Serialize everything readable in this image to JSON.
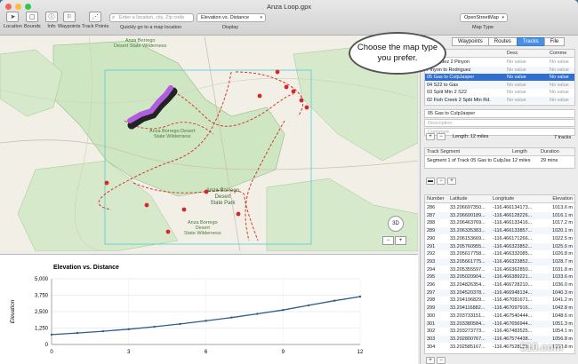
{
  "window": {
    "title": "Anza Loop.gpx"
  },
  "toolbar": {
    "items": [
      {
        "label": "Location",
        "icon": "location-arrow-icon"
      },
      {
        "label": "Bounds",
        "icon": "bounds-icon"
      },
      {
        "label": "Info",
        "icon": "info-icon"
      },
      {
        "label": "Waypoints",
        "icon": "waypoints-icon"
      },
      {
        "label": "Track Points",
        "icon": "track-points-icon"
      }
    ],
    "search_placeholder": "Enter a location, city, Zip code",
    "search_caption": "Quickly go to a map location",
    "display_value": "Elevation vs. Distance",
    "display_caption": "Display",
    "maptype_value": "OpenStreetMap",
    "maptype_caption": "Map Type"
  },
  "map": {
    "labels": {
      "park_north": "Anza Borrego\nDesert State Wilderness",
      "park_mid": "Anza Borrego Desert\nState Wilderness",
      "park_center": "Anza-Borrego\nDesert\nState Park",
      "park_south": "Anza Borrego\nDesert\nState Wilderness"
    },
    "zoom_3d": "3D",
    "zoom_minus": "−",
    "zoom_plus": "+"
  },
  "chart_data": {
    "type": "line",
    "title": "Elevation vs. Distance",
    "ylabel": "Elevation",
    "xlabel": "",
    "xlim": [
      0,
      12
    ],
    "ylim": [
      0,
      5000
    ],
    "xticks": [
      "0",
      "3",
      "6",
      "9",
      "12"
    ],
    "yticks": [
      "0",
      "1,250",
      "2,500",
      "3,750",
      "5,000"
    ],
    "x": [
      0,
      1,
      2,
      3,
      4,
      5,
      6,
      7,
      8,
      9,
      10,
      11,
      12
    ],
    "y": [
      750,
      870,
      1010,
      1160,
      1350,
      1560,
      1800,
      2050,
      2330,
      2620,
      2980,
      3330,
      3640
    ]
  },
  "right_panel": {
    "tabs": [
      "Waypoints",
      "Routes",
      "Tracks",
      "File"
    ],
    "selected_tab": "Tracks",
    "tracks_header": [
      "Name",
      "Desc",
      "Comme"
    ],
    "tracks": [
      {
        "name": "Rodriguez 2 Pinyon",
        "desc": "No value",
        "comm": "No value",
        "selected": false
      },
      {
        "name": "Pinyon to Rodriguez",
        "desc": "No value",
        "comm": "No value",
        "selected": false
      },
      {
        "name": "05 Gas to CulpJasper",
        "desc": "No value",
        "comm": "No value",
        "selected": true
      },
      {
        "name": "04 S22 to Gas",
        "desc": "No value",
        "comm": "No value",
        "selected": false
      },
      {
        "name": "03 Split Mtn 2 S22",
        "desc": "No value",
        "comm": "No value",
        "selected": false
      },
      {
        "name": "02 Fish Creek 2 Split Mtn Rd.",
        "desc": "No value",
        "comm": "No value",
        "selected": false
      }
    ],
    "selected_name": "05 Gas to CulpJasper",
    "desc_placeholder": "Description",
    "comment_placeholder": "Comment",
    "length_text": "Length: 12 miles",
    "tracks_count": "7 tracks",
    "segment_header": [
      "Track Segment",
      "Length",
      "Duration"
    ],
    "segment_row": {
      "name": "Segment 1 of Track 05 Gas to CulpJasper",
      "length": "12 miles",
      "duration": "29 mins"
    },
    "points_header": [
      "Number",
      "Latitude",
      "Longitude",
      "Elevation"
    ],
    "points": [
      {
        "n": "286",
        "lat": "33.206697350...",
        "lon": "-116.466134173...",
        "el": "1013.6 m"
      },
      {
        "n": "287",
        "lat": "33.206600189...",
        "lon": "-116.466128226...",
        "el": "1016.1 m"
      },
      {
        "n": "288",
        "lat": "33.206463769...",
        "lon": "-116.466133416...",
        "el": "1017.2 m"
      },
      {
        "n": "289",
        "lat": "33.206335383...",
        "lon": "-116.466133857...",
        "el": "1020.1 m"
      },
      {
        "n": "290",
        "lat": "33.206153669...",
        "lon": "-116.466171266...",
        "el": "1022.5 m"
      },
      {
        "n": "291",
        "lat": "33.205760955...",
        "lon": "-116.466323852...",
        "el": "1025.6 m"
      },
      {
        "n": "292",
        "lat": "33.205617758...",
        "lon": "-116.466332085...",
        "el": "1026.8 m"
      },
      {
        "n": "293",
        "lat": "33.205661775...",
        "lon": "-116.466323852...",
        "el": "1028.7 m"
      },
      {
        "n": "294",
        "lat": "33.205355597...",
        "lon": "-116.466362850...",
        "el": "1031.8 m"
      },
      {
        "n": "295",
        "lat": "33.205020904...",
        "lon": "-116.466389221...",
        "el": "1033.6 m"
      },
      {
        "n": "296",
        "lat": "33.204826354...",
        "lon": "-116.466728210...",
        "el": "1036.0 m"
      },
      {
        "n": "297",
        "lat": "33.204520378...",
        "lon": "-116.466948134...",
        "el": "1040.3 m"
      },
      {
        "n": "298",
        "lat": "33.204196829...",
        "lon": "-116.467081671...",
        "el": "1041.2 m"
      },
      {
        "n": "299",
        "lat": "33.204116882...",
        "lon": "-116.467097916...",
        "el": "1042.8 m"
      },
      {
        "n": "300",
        "lat": "33.203733151...",
        "lon": "-116.467540444...",
        "el": "1048.6 m"
      },
      {
        "n": "301",
        "lat": "33.203380584...",
        "lon": "-116.467656944...",
        "el": "1051.3 m"
      },
      {
        "n": "302",
        "lat": "33.203273773...",
        "lon": "-116.467483525...",
        "el": "1054.1 m"
      },
      {
        "n": "303",
        "lat": "33.202800767...",
        "lon": "-116.467574438...",
        "el": "1056.8 m"
      },
      {
        "n": "304",
        "lat": "33.202585167...",
        "lon": "-116.467528233...",
        "el": "1058.8 m"
      }
    ],
    "footer_left": "0 Sel",
    "footer_mid": "",
    "footer_right": ""
  },
  "callout": {
    "text": "Choose the map type you prefer."
  },
  "watermark": "510.com"
}
